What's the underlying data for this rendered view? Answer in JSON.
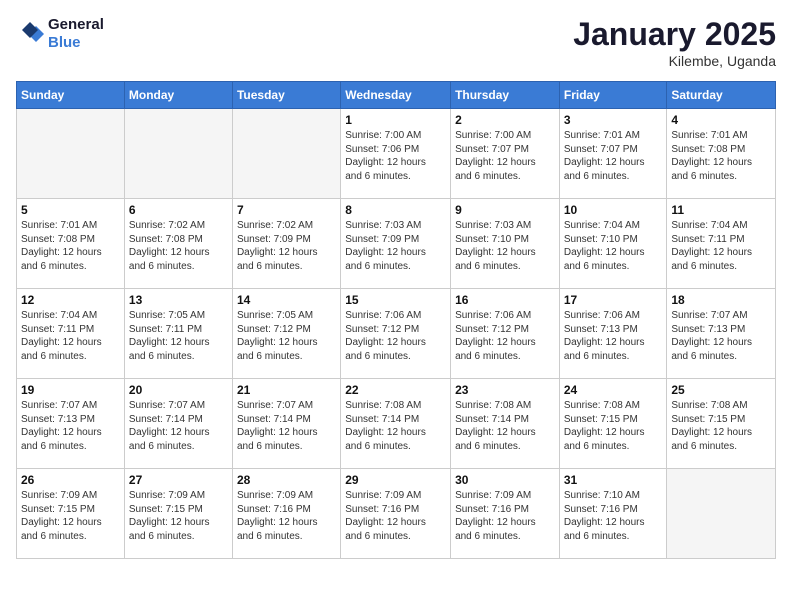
{
  "header": {
    "logo_line1": "General",
    "logo_line2": "Blue",
    "month_title": "January 2025",
    "location": "Kilembe, Uganda"
  },
  "weekdays": [
    "Sunday",
    "Monday",
    "Tuesday",
    "Wednesday",
    "Thursday",
    "Friday",
    "Saturday"
  ],
  "weeks": [
    [
      {
        "day": "",
        "info": ""
      },
      {
        "day": "",
        "info": ""
      },
      {
        "day": "",
        "info": ""
      },
      {
        "day": "1",
        "info": "Sunrise: 7:00 AM\nSunset: 7:06 PM\nDaylight: 12 hours\nand 6 minutes."
      },
      {
        "day": "2",
        "info": "Sunrise: 7:00 AM\nSunset: 7:07 PM\nDaylight: 12 hours\nand 6 minutes."
      },
      {
        "day": "3",
        "info": "Sunrise: 7:01 AM\nSunset: 7:07 PM\nDaylight: 12 hours\nand 6 minutes."
      },
      {
        "day": "4",
        "info": "Sunrise: 7:01 AM\nSunset: 7:08 PM\nDaylight: 12 hours\nand 6 minutes."
      }
    ],
    [
      {
        "day": "5",
        "info": "Sunrise: 7:01 AM\nSunset: 7:08 PM\nDaylight: 12 hours\nand 6 minutes."
      },
      {
        "day": "6",
        "info": "Sunrise: 7:02 AM\nSunset: 7:08 PM\nDaylight: 12 hours\nand 6 minutes."
      },
      {
        "day": "7",
        "info": "Sunrise: 7:02 AM\nSunset: 7:09 PM\nDaylight: 12 hours\nand 6 minutes."
      },
      {
        "day": "8",
        "info": "Sunrise: 7:03 AM\nSunset: 7:09 PM\nDaylight: 12 hours\nand 6 minutes."
      },
      {
        "day": "9",
        "info": "Sunrise: 7:03 AM\nSunset: 7:10 PM\nDaylight: 12 hours\nand 6 minutes."
      },
      {
        "day": "10",
        "info": "Sunrise: 7:04 AM\nSunset: 7:10 PM\nDaylight: 12 hours\nand 6 minutes."
      },
      {
        "day": "11",
        "info": "Sunrise: 7:04 AM\nSunset: 7:11 PM\nDaylight: 12 hours\nand 6 minutes."
      }
    ],
    [
      {
        "day": "12",
        "info": "Sunrise: 7:04 AM\nSunset: 7:11 PM\nDaylight: 12 hours\nand 6 minutes."
      },
      {
        "day": "13",
        "info": "Sunrise: 7:05 AM\nSunset: 7:11 PM\nDaylight: 12 hours\nand 6 minutes."
      },
      {
        "day": "14",
        "info": "Sunrise: 7:05 AM\nSunset: 7:12 PM\nDaylight: 12 hours\nand 6 minutes."
      },
      {
        "day": "15",
        "info": "Sunrise: 7:06 AM\nSunset: 7:12 PM\nDaylight: 12 hours\nand 6 minutes."
      },
      {
        "day": "16",
        "info": "Sunrise: 7:06 AM\nSunset: 7:12 PM\nDaylight: 12 hours\nand 6 minutes."
      },
      {
        "day": "17",
        "info": "Sunrise: 7:06 AM\nSunset: 7:13 PM\nDaylight: 12 hours\nand 6 minutes."
      },
      {
        "day": "18",
        "info": "Sunrise: 7:07 AM\nSunset: 7:13 PM\nDaylight: 12 hours\nand 6 minutes."
      }
    ],
    [
      {
        "day": "19",
        "info": "Sunrise: 7:07 AM\nSunset: 7:13 PM\nDaylight: 12 hours\nand 6 minutes."
      },
      {
        "day": "20",
        "info": "Sunrise: 7:07 AM\nSunset: 7:14 PM\nDaylight: 12 hours\nand 6 minutes."
      },
      {
        "day": "21",
        "info": "Sunrise: 7:07 AM\nSunset: 7:14 PM\nDaylight: 12 hours\nand 6 minutes."
      },
      {
        "day": "22",
        "info": "Sunrise: 7:08 AM\nSunset: 7:14 PM\nDaylight: 12 hours\nand 6 minutes."
      },
      {
        "day": "23",
        "info": "Sunrise: 7:08 AM\nSunset: 7:14 PM\nDaylight: 12 hours\nand 6 minutes."
      },
      {
        "day": "24",
        "info": "Sunrise: 7:08 AM\nSunset: 7:15 PM\nDaylight: 12 hours\nand 6 minutes."
      },
      {
        "day": "25",
        "info": "Sunrise: 7:08 AM\nSunset: 7:15 PM\nDaylight: 12 hours\nand 6 minutes."
      }
    ],
    [
      {
        "day": "26",
        "info": "Sunrise: 7:09 AM\nSunset: 7:15 PM\nDaylight: 12 hours\nand 6 minutes."
      },
      {
        "day": "27",
        "info": "Sunrise: 7:09 AM\nSunset: 7:15 PM\nDaylight: 12 hours\nand 6 minutes."
      },
      {
        "day": "28",
        "info": "Sunrise: 7:09 AM\nSunset: 7:16 PM\nDaylight: 12 hours\nand 6 minutes."
      },
      {
        "day": "29",
        "info": "Sunrise: 7:09 AM\nSunset: 7:16 PM\nDaylight: 12 hours\nand 6 minutes."
      },
      {
        "day": "30",
        "info": "Sunrise: 7:09 AM\nSunset: 7:16 PM\nDaylight: 12 hours\nand 6 minutes."
      },
      {
        "day": "31",
        "info": "Sunrise: 7:10 AM\nSunset: 7:16 PM\nDaylight: 12 hours\nand 6 minutes."
      },
      {
        "day": "",
        "info": ""
      }
    ]
  ]
}
